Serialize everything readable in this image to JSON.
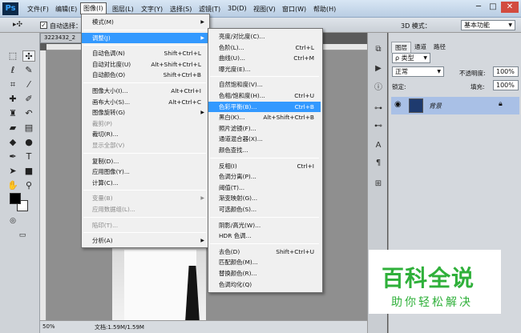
{
  "app": {
    "logo": "Ps"
  },
  "menubar": {
    "items": [
      "文件(F)",
      "编辑(E)",
      "图像(I)",
      "图层(L)",
      "文字(Y)",
      "选择(S)",
      "滤镜(T)",
      "3D(D)",
      "视图(V)",
      "窗口(W)",
      "帮助(H)"
    ]
  },
  "window_controls": {
    "minimize": "─",
    "maximize": "□",
    "close": "✕"
  },
  "options_bar": {
    "auto_select_label": "自动选择：",
    "mode_3d": "3D 模式：",
    "workspace": "基本功能"
  },
  "document": {
    "tab_label": "3223432_2",
    "zoom": "50%",
    "doc_info": "文档:1.59M/1.59M"
  },
  "image_menu": {
    "items": [
      {
        "label": "模式(M)",
        "shortcut": "",
        "submenu": true,
        "disabled": false
      },
      {
        "sep": true
      },
      {
        "label": "调整(J)",
        "shortcut": "",
        "submenu": true,
        "disabled": false,
        "highlight": true
      },
      {
        "sep": true
      },
      {
        "label": "自动色调(N)",
        "shortcut": "Shift+Ctrl+L",
        "disabled": false
      },
      {
        "label": "自动对比度(U)",
        "shortcut": "Alt+Shift+Ctrl+L",
        "disabled": false
      },
      {
        "label": "自动颜色(O)",
        "shortcut": "Shift+Ctrl+B",
        "disabled": false
      },
      {
        "sep": true
      },
      {
        "label": "图像大小(I)...",
        "shortcut": "Alt+Ctrl+I",
        "disabled": false
      },
      {
        "label": "画布大小(S)...",
        "shortcut": "Alt+Ctrl+C",
        "disabled": false
      },
      {
        "label": "图像旋转(G)",
        "shortcut": "",
        "submenu": true,
        "disabled": false
      },
      {
        "label": "裁剪(P)",
        "shortcut": "",
        "disabled": true
      },
      {
        "label": "裁切(R)...",
        "shortcut": "",
        "disabled": false
      },
      {
        "label": "显示全部(V)",
        "shortcut": "",
        "disabled": true
      },
      {
        "sep": true
      },
      {
        "label": "复制(D)...",
        "shortcut": "",
        "disabled": false
      },
      {
        "label": "应用图像(Y)...",
        "shortcut": "",
        "disabled": false
      },
      {
        "label": "计算(C)...",
        "shortcut": "",
        "disabled": false
      },
      {
        "sep": true
      },
      {
        "label": "变量(B)",
        "shortcut": "",
        "submenu": true,
        "disabled": true
      },
      {
        "label": "应用数据组(L)...",
        "shortcut": "",
        "disabled": true
      },
      {
        "sep": true
      },
      {
        "label": "陷印(T)...",
        "shortcut": "",
        "disabled": true
      },
      {
        "sep": true
      },
      {
        "label": "分析(A)",
        "shortcut": "",
        "submenu": true,
        "disabled": false
      }
    ]
  },
  "adjust_menu": {
    "items": [
      {
        "label": "亮度/对比度(C)...",
        "shortcut": ""
      },
      {
        "label": "色阶(L)...",
        "shortcut": "Ctrl+L"
      },
      {
        "label": "曲线(U)...",
        "shortcut": "Ctrl+M"
      },
      {
        "label": "曝光度(E)...",
        "shortcut": ""
      },
      {
        "sep": true
      },
      {
        "label": "自然饱和度(V)...",
        "shortcut": ""
      },
      {
        "label": "色相/饱和度(H)...",
        "shortcut": "Ctrl+U"
      },
      {
        "label": "色彩平衡(B)...",
        "shortcut": "Ctrl+B",
        "highlight": true
      },
      {
        "label": "黑白(K)...",
        "shortcut": "Alt+Shift+Ctrl+B"
      },
      {
        "label": "照片滤镜(F)...",
        "shortcut": ""
      },
      {
        "label": "通道混合器(X)...",
        "shortcut": ""
      },
      {
        "label": "颜色查找...",
        "shortcut": ""
      },
      {
        "sep": true
      },
      {
        "label": "反相(I)",
        "shortcut": "Ctrl+I"
      },
      {
        "label": "色调分离(P)...",
        "shortcut": ""
      },
      {
        "label": "阈值(T)...",
        "shortcut": ""
      },
      {
        "label": "渐变映射(G)...",
        "shortcut": ""
      },
      {
        "label": "可选颜色(S)...",
        "shortcut": ""
      },
      {
        "sep": true
      },
      {
        "label": "阴影/高光(W)...",
        "shortcut": ""
      },
      {
        "label": "HDR 色调...",
        "shortcut": ""
      },
      {
        "sep": true
      },
      {
        "label": "去色(D)",
        "shortcut": "Shift+Ctrl+U"
      },
      {
        "label": "匹配颜色(M)...",
        "shortcut": ""
      },
      {
        "label": "替换颜色(R)...",
        "shortcut": ""
      },
      {
        "label": "色调均化(Q)",
        "shortcut": ""
      }
    ]
  },
  "layers_panel": {
    "tabs": [
      "图层",
      "通道",
      "路径"
    ],
    "kind_filter": "ρ 类型",
    "blend_mode": "正常",
    "opacity_label": "不透明度:",
    "opacity_value": "100%",
    "lock_label": "锁定:",
    "fill_label": "填充:",
    "fill_value": "100%",
    "layer_name": "背景"
  },
  "watermark": {
    "title": "百科全说",
    "subtitle": "助你轻松解决"
  },
  "colors": {
    "highlight": "#3399ff",
    "layer_selected": "#a9c0e6",
    "watermark_green": "#2fb03a"
  }
}
